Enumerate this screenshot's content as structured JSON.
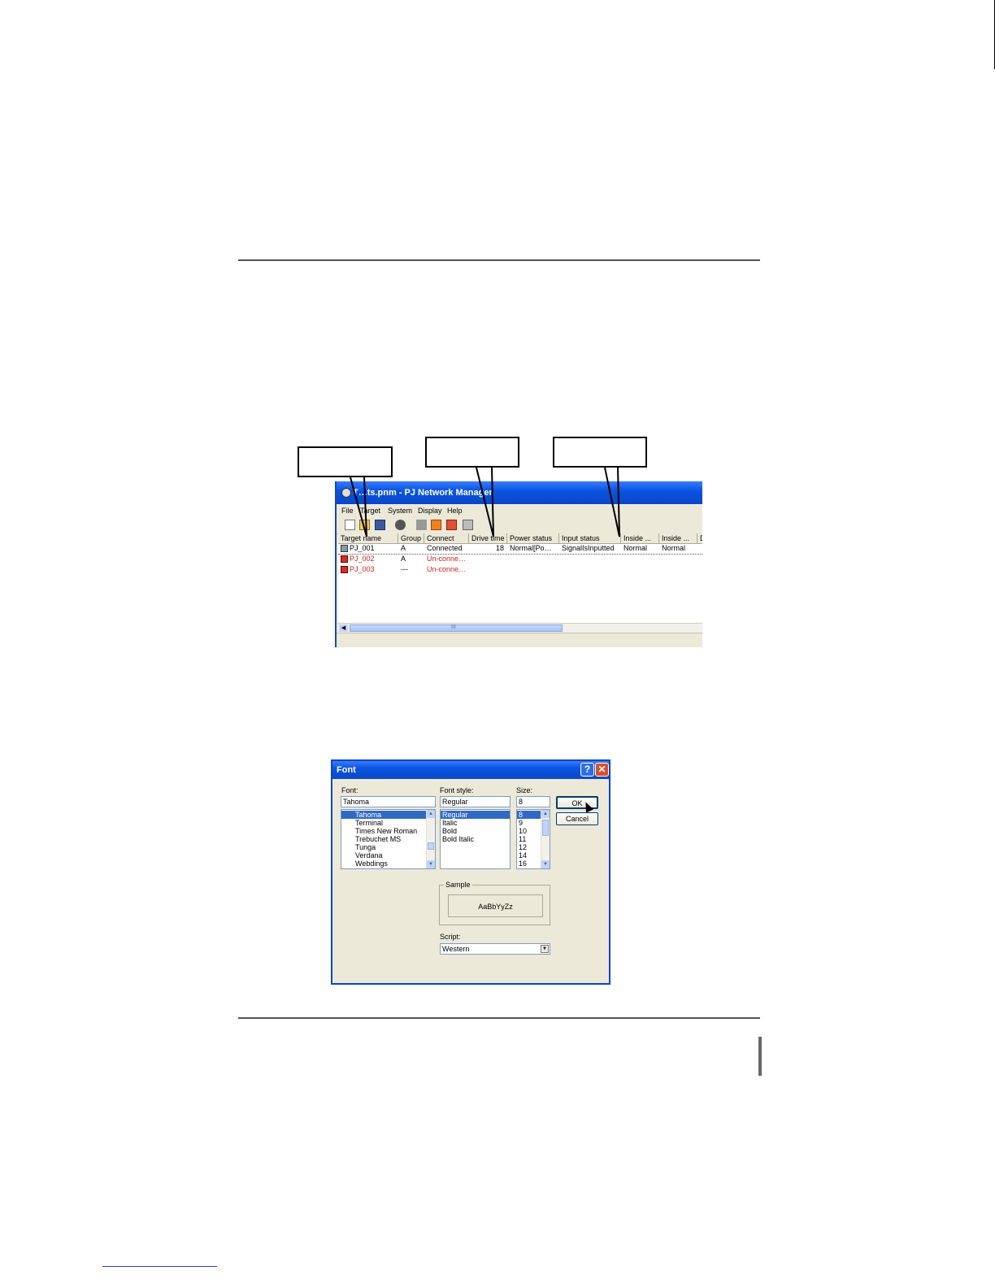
{
  "app": {
    "title": "T…ts.pnm - PJ Network Manager",
    "menu": [
      "File",
      "Target",
      "System",
      "Display",
      "Help"
    ],
    "columns": [
      "Target name",
      "Group",
      "Connect",
      "Drive time",
      "Power status",
      "Input status",
      "Inside ...",
      "Inside ...",
      "D"
    ],
    "rows": [
      {
        "name": "PJ_001",
        "group": "A",
        "connect": "Connected",
        "drive_time": "18",
        "power": "Normal[Po…",
        "input": "SignalIsInputted",
        "inside1": "Normal",
        "inside2": "Normal",
        "status": "connected"
      },
      {
        "name": "PJ_002",
        "group": "A",
        "connect": "Un-conne…",
        "status": "unconnected"
      },
      {
        "name": "PJ_003",
        "group": "---",
        "connect": "Un-conne…",
        "status": "unconnected"
      }
    ],
    "scroll_marker": "III"
  },
  "dialog": {
    "title": "Font",
    "help_label": "?",
    "close_label": "✕",
    "font_label": "Font:",
    "font_value": "Tahoma",
    "fonts": [
      "Tahoma",
      "Terminal",
      "Times New Roman",
      "Trebuchet MS",
      "Tunga",
      "Verdana",
      "Webdings"
    ],
    "style_label": "Font style:",
    "style_value": "Regular",
    "styles": [
      "Regular",
      "Italic",
      "Bold",
      "Bold Italic"
    ],
    "size_label": "Size:",
    "size_value": "8",
    "sizes": [
      "8",
      "9",
      "10",
      "11",
      "12",
      "14",
      "16"
    ],
    "ok_label": "OK",
    "cancel_label": "Cancel",
    "sample_label": "Sample",
    "sample_text": "AaBbYyZz",
    "script_label": "Script:",
    "script_value": "Western"
  }
}
